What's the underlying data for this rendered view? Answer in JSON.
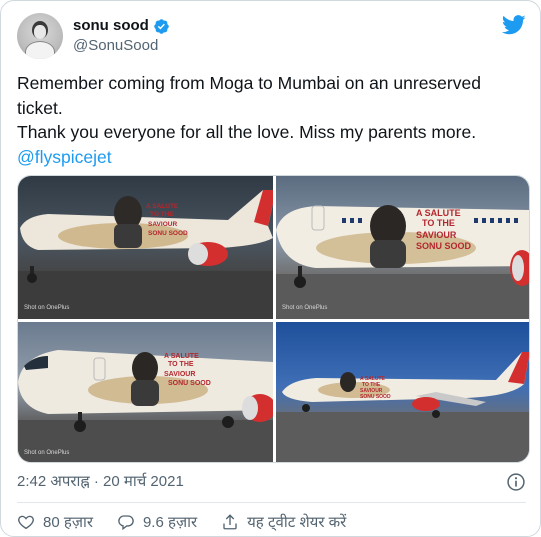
{
  "author": {
    "display_name": "sonu sood",
    "handle": "@SonuSood",
    "verified": true
  },
  "tweet": {
    "lines": [
      "Remember coming from Moga to Mumbai on an unreserved",
      "ticket.",
      "Thank you everyone for all the love. Miss my parents more."
    ],
    "mention": "@flyspicejet"
  },
  "media": {
    "livery_text": [
      "A SALUTE",
      "TO THE",
      "SAVIOUR",
      "SONU SOOD"
    ],
    "watermark": "Shot on OnePlus"
  },
  "meta": {
    "timestamp": "2:42 अपराह्न · 20 मार्च 2021"
  },
  "actions": {
    "likes": "80 हज़ार",
    "replies": "9.6 हज़ार",
    "share": "यह ट्वीट शेयर करें"
  },
  "colors": {
    "accent": "#1d9bf0",
    "spicejet_red": "#d32f2f",
    "muted_text": "#536471"
  }
}
